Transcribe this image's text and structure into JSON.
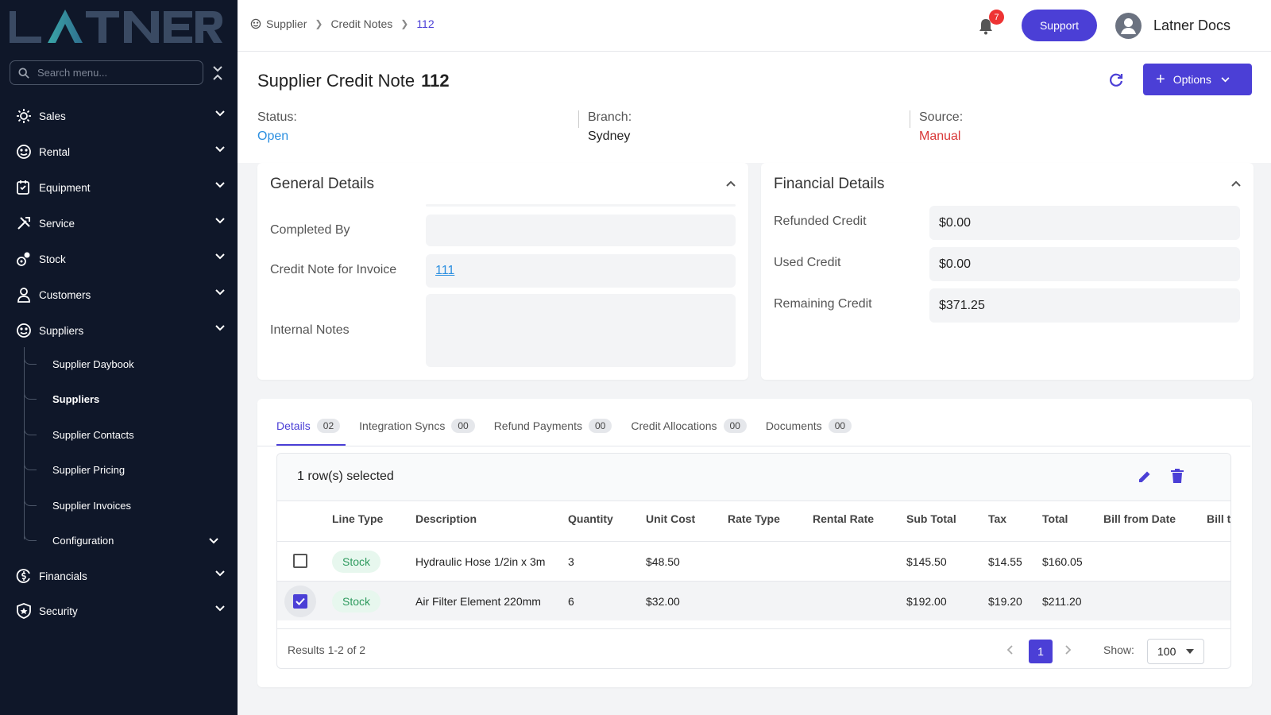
{
  "app": {
    "logo_text": "LATNER"
  },
  "sidebar": {
    "search_placeholder": "Search menu...",
    "items": [
      {
        "label": "Sales",
        "icon": "sales-icon"
      },
      {
        "label": "Rental",
        "icon": "rental-icon"
      },
      {
        "label": "Equipment",
        "icon": "equipment-icon"
      },
      {
        "label": "Service",
        "icon": "service-icon"
      },
      {
        "label": "Stock",
        "icon": "stock-icon"
      },
      {
        "label": "Customers",
        "icon": "customers-icon"
      },
      {
        "label": "Suppliers",
        "icon": "suppliers-icon"
      },
      {
        "label": "Financials",
        "icon": "financials-icon"
      },
      {
        "label": "Security",
        "icon": "security-icon"
      }
    ],
    "sub_items": [
      {
        "label": "Supplier Daybook"
      },
      {
        "label": "Suppliers",
        "active": true
      },
      {
        "label": "Supplier Contacts"
      },
      {
        "label": "Supplier Pricing"
      },
      {
        "label": "Supplier Invoices"
      },
      {
        "label": "Configuration"
      }
    ]
  },
  "topbar": {
    "breadcrumbs": [
      "Supplier",
      "Credit Notes",
      "112"
    ],
    "notification_count": "7",
    "support_label": "Support",
    "user_name": "Latner Docs"
  },
  "page": {
    "title": "Supplier Credit Note",
    "number": "112",
    "options_label": "Options",
    "meta": [
      {
        "label": "Status:",
        "value": "Open",
        "color": "#2b8fe0"
      },
      {
        "label": "Branch:",
        "value": "Sydney",
        "color": "#222222"
      },
      {
        "label": "Source:",
        "value": "Manual",
        "color": "#d93838"
      }
    ]
  },
  "general_details": {
    "title": "General Details",
    "fields": [
      {
        "label": "Completed By",
        "value": ""
      },
      {
        "label": "Credit Note for Invoice",
        "value": "111"
      },
      {
        "label": "Internal Notes",
        "value": ""
      }
    ]
  },
  "financial_details": {
    "title": "Financial Details",
    "fields": [
      {
        "label": "Refunded Credit",
        "value": "$0.00"
      },
      {
        "label": "Used Credit",
        "value": "$0.00"
      },
      {
        "label": "Remaining Credit",
        "value": "$371.25"
      }
    ]
  },
  "tabs": [
    {
      "label": "Details",
      "count": "02",
      "active": true
    },
    {
      "label": "Integration Syncs",
      "count": "00"
    },
    {
      "label": "Refund Payments",
      "count": "00"
    },
    {
      "label": "Credit Allocations",
      "count": "00"
    },
    {
      "label": "Documents",
      "count": "00"
    }
  ],
  "table": {
    "selection_text": "1 row(s) selected",
    "columns": [
      "Line Type",
      "Description",
      "Quantity",
      "Unit Cost",
      "Rate Type",
      "Rental Rate",
      "Sub Total",
      "Tax",
      "Total",
      "Bill from Date",
      "Bill to"
    ],
    "rows": [
      {
        "selected": false,
        "line_type": "Stock",
        "description": "Hydraulic Hose 1/2in x 3m",
        "quantity": "3",
        "unit_cost": "$48.50",
        "rate_type": "",
        "rental_rate": "",
        "sub_total": "$145.50",
        "tax": "$14.55",
        "total": "$160.05",
        "bill_from": ""
      },
      {
        "selected": true,
        "line_type": "Stock",
        "description": "Air Filter Element 220mm",
        "quantity": "6",
        "unit_cost": "$32.00",
        "rate_type": "",
        "rental_rate": "",
        "sub_total": "$192.00",
        "tax": "$19.20",
        "total": "$211.20",
        "bill_from": ""
      }
    ],
    "results_text": "Results 1-2 of 2",
    "current_page": "1",
    "show_label": "Show:",
    "page_size": "100"
  },
  "colors": {
    "accent": "#4b3fd6",
    "sidebar_bg": "#0f1729",
    "link": "#2b8fe0",
    "danger": "#d93838"
  }
}
